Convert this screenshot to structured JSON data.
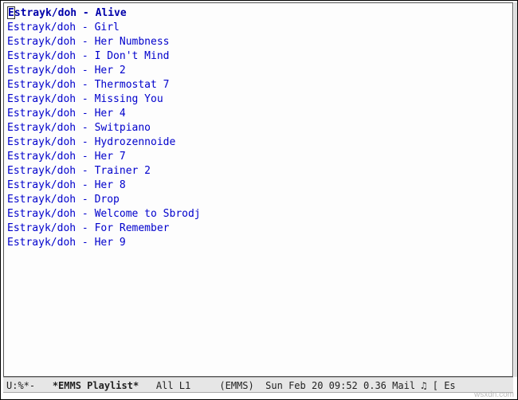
{
  "playlist": {
    "tracks": [
      "Estrayk/doh - Alive",
      "Estrayk/doh - Girl",
      "Estrayk/doh - Her Numbness",
      "Estrayk/doh - I Don't Mind",
      "Estrayk/doh - Her 2",
      "Estrayk/doh - Thermostat 7",
      "Estrayk/doh - Missing You",
      "Estrayk/doh - Her 4",
      "Estrayk/doh - Switpiano",
      "Estrayk/doh - Hydrozennoide",
      "Estrayk/doh - Her 7",
      "Estrayk/doh - Trainer 2",
      "Estrayk/doh - Her 8",
      "Estrayk/doh - Drop",
      "Estrayk/doh - Welcome to Sbrodj",
      "Estrayk/doh - For Remember",
      "Estrayk/doh - Her 9"
    ],
    "current_index": 0
  },
  "modeline": {
    "left_status": "U:%*-",
    "buffer_name": "*EMMS Playlist*",
    "position": "All L1",
    "mode": "(EMMS)",
    "datetime": "Sun Feb 20 09:52",
    "load": "0.36",
    "mail": "Mail",
    "now_playing_prefix": "[ Es"
  },
  "watermark": "wsxdn.com"
}
